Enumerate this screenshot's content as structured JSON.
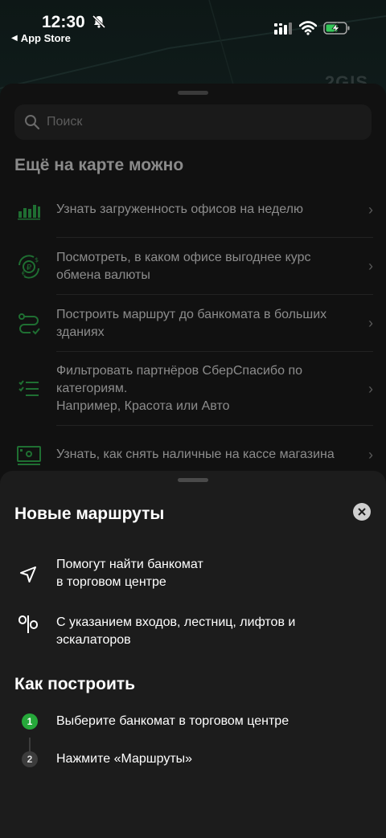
{
  "status_bar": {
    "time": "12:30",
    "back_app": "App Store"
  },
  "map": {
    "watermark": "2GIS"
  },
  "back_sheet": {
    "search_placeholder": "Поиск",
    "section_title": "Ещё на карте можно",
    "items": [
      {
        "icon": "bar-chart-icon",
        "text": "Узнать загруженность офисов на неделю"
      },
      {
        "icon": "currency-exchange-icon",
        "text": "Посмотреть, в каком офисе выгоднее курс обмена валюты"
      },
      {
        "icon": "route-icon",
        "text": "Построить маршрут до банкомата в больших зданиях"
      },
      {
        "icon": "filter-list-icon",
        "text": "Фильтровать партнёров СберСпасибо по категориям.\nНапример, Красота или Авто"
      },
      {
        "icon": "cash-register-icon",
        "text": "Узнать, как снять наличные на кассе магазина"
      }
    ]
  },
  "front_sheet": {
    "title": "Новые маршруты",
    "features": [
      {
        "icon": "navigation-arrow-icon",
        "text": "Помогут найти банкомат\nв торговом центре"
      },
      {
        "icon": "signpost-icon",
        "text": "С указанием входов, лестниц, лифтов и эскалаторов"
      }
    ],
    "how_title": "Как построить",
    "steps": [
      {
        "number": "1",
        "text": "Выберите банкомат в торговом центре",
        "active": true
      },
      {
        "number": "2",
        "text": "Нажмите «Маршруты»",
        "active": false
      }
    ]
  },
  "colors": {
    "accent_green": "#26a83a",
    "icon_green": "#1f8f3a"
  }
}
